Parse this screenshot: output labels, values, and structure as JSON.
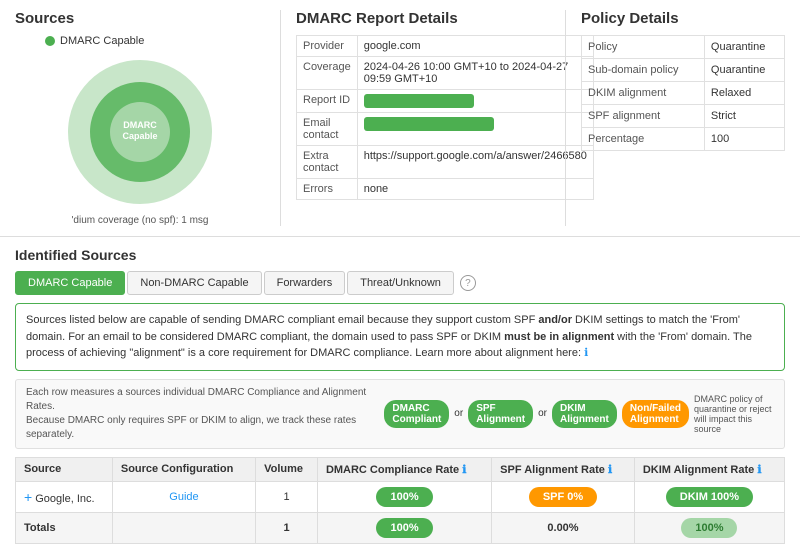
{
  "sources": {
    "title": "Sources",
    "legend": "DMARC Capable",
    "donut_label": "'dium coverage (no spf): 1 msg",
    "donut": {
      "outer_color": "#a5d6a7",
      "inner_color": "#4caf50",
      "center_text": "DMARC Capable"
    }
  },
  "dmarc_report": {
    "title": "DMARC Report Details",
    "rows": [
      {
        "label": "Provider",
        "value": "google.com",
        "type": "text"
      },
      {
        "label": "Coverage",
        "value": "2024-04-26 10:00 GMT+10 to 2024-04-27 09:59 GMT+10",
        "type": "text"
      },
      {
        "label": "Report ID",
        "value": "",
        "type": "bar"
      },
      {
        "label": "Email contact",
        "value": "",
        "type": "bar"
      },
      {
        "label": "Extra contact",
        "value": "https://support.google.com/a/answer/2466580",
        "type": "text"
      },
      {
        "label": "Errors",
        "value": "none",
        "type": "text"
      }
    ]
  },
  "policy": {
    "title": "Policy Details",
    "rows": [
      {
        "label": "Policy",
        "value": "Quarantine"
      },
      {
        "label": "Sub-domain policy",
        "value": "Quarantine"
      },
      {
        "label": "DKIM alignment",
        "value": "Relaxed"
      },
      {
        "label": "SPF alignment",
        "value": "Strict"
      },
      {
        "label": "Percentage",
        "value": "100"
      }
    ]
  },
  "identified_sources": {
    "title": "Identified Sources",
    "tabs": [
      {
        "label": "DMARC Capable",
        "active": true
      },
      {
        "label": "Non-DMARC Capable",
        "active": false
      },
      {
        "label": "Forwarders",
        "active": false
      },
      {
        "label": "Threat/Unknown",
        "active": false
      }
    ],
    "info_text_1": "Sources listed below are capable of sending DMARC compliant email because they support custom SPF ",
    "info_bold_1": "and/or",
    "info_text_2": " DKIM settings to match the 'From' domain. For an email to be considered DMARC compliant, the domain used to pass SPF or DKIM ",
    "info_bold_2": "must be in alignment",
    "info_text_3": " with the 'From' domain. The process of achieving \"alignment\" is a core requirement for DMARC compliance. Learn more about alignment here:",
    "metrics_left": "Each row measures a sources individual DMARC Compliance and Alignment Rates. Because DMARC only requires SPF or DKIM to align, we track these rates separately.",
    "metrics_pills": [
      {
        "label": "DMARC Compliant",
        "color": "green"
      },
      {
        "label": "or",
        "type": "text"
      },
      {
        "label": "SPF Alignment",
        "color": "green"
      },
      {
        "label": "or",
        "type": "text"
      },
      {
        "label": "DKIM Alignment",
        "color": "green"
      },
      {
        "label": "Non/Failed Alignment",
        "color": "orange"
      }
    ],
    "metrics_note": "DMARC policy of quarantine or reject will impact this source",
    "columns": [
      "Source",
      "Source Configuration",
      "Volume",
      "DMARC Compliance Rate",
      "SPF Alignment Rate",
      "DKIM Alignment Rate"
    ],
    "rows": [
      {
        "source": "Google, Inc.",
        "config": "Guide",
        "volume": "1",
        "dmarc_rate": "100%",
        "spf_rate": "SPF 0%",
        "dkim_rate": "DKIM 100%",
        "dmarc_color": "green",
        "spf_color": "orange",
        "dkim_color": "green"
      }
    ],
    "totals": {
      "label": "Totals",
      "volume": "1",
      "dmarc_rate": "100%",
      "spf_rate": "0.00%",
      "dkim_rate": "100%"
    },
    "threat_unknown": "Threat Unknown"
  }
}
